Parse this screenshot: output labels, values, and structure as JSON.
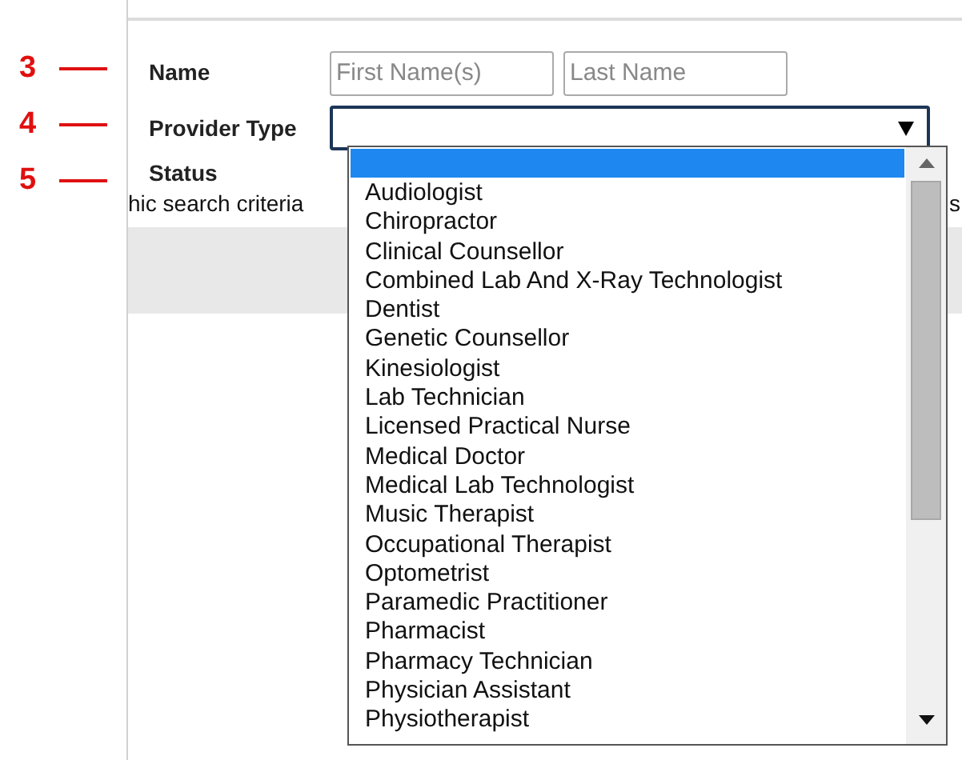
{
  "markers": [
    {
      "label": "3"
    },
    {
      "label": "4"
    },
    {
      "label": "5"
    }
  ],
  "form": {
    "name_label": "Name",
    "first_name": {
      "placeholder": "First Name(s)"
    },
    "last_name": {
      "placeholder": "Last Name"
    },
    "provider_type_label": "Provider Type",
    "status_label": "Status",
    "hint_left": "hic search criteria",
    "hint_right": "s"
  },
  "dropdown": {
    "expanded": true,
    "blank_option": {
      "selected": true
    },
    "options": [
      {
        "label": "Audiologist",
        "selected": false
      },
      {
        "label": "Chiropractor",
        "selected": false
      },
      {
        "label": "Clinical Counsellor",
        "selected": false
      },
      {
        "label": "Combined Lab And X-Ray Technologist",
        "selected": false
      },
      {
        "label": "Dentist",
        "selected": false
      },
      {
        "label": "Genetic Counsellor",
        "selected": false
      },
      {
        "label": "Kinesiologist",
        "selected": false
      },
      {
        "label": "Lab Technician",
        "selected": false
      },
      {
        "label": "Licensed Practical Nurse",
        "selected": false
      },
      {
        "label": "Medical Doctor",
        "selected": false
      },
      {
        "label": "Medical Lab Technologist",
        "selected": false
      },
      {
        "label": "Music Therapist",
        "selected": false
      },
      {
        "label": "Occupational Therapist",
        "selected": false
      },
      {
        "label": "Optometrist",
        "selected": false
      },
      {
        "label": "Paramedic Practitioner",
        "selected": false
      },
      {
        "label": "Pharmacist",
        "selected": false
      },
      {
        "label": "Pharmacy Technician",
        "selected": false
      },
      {
        "label": "Physician Assistant",
        "selected": false
      },
      {
        "label": "Physiotherapist",
        "selected": false
      }
    ]
  }
}
